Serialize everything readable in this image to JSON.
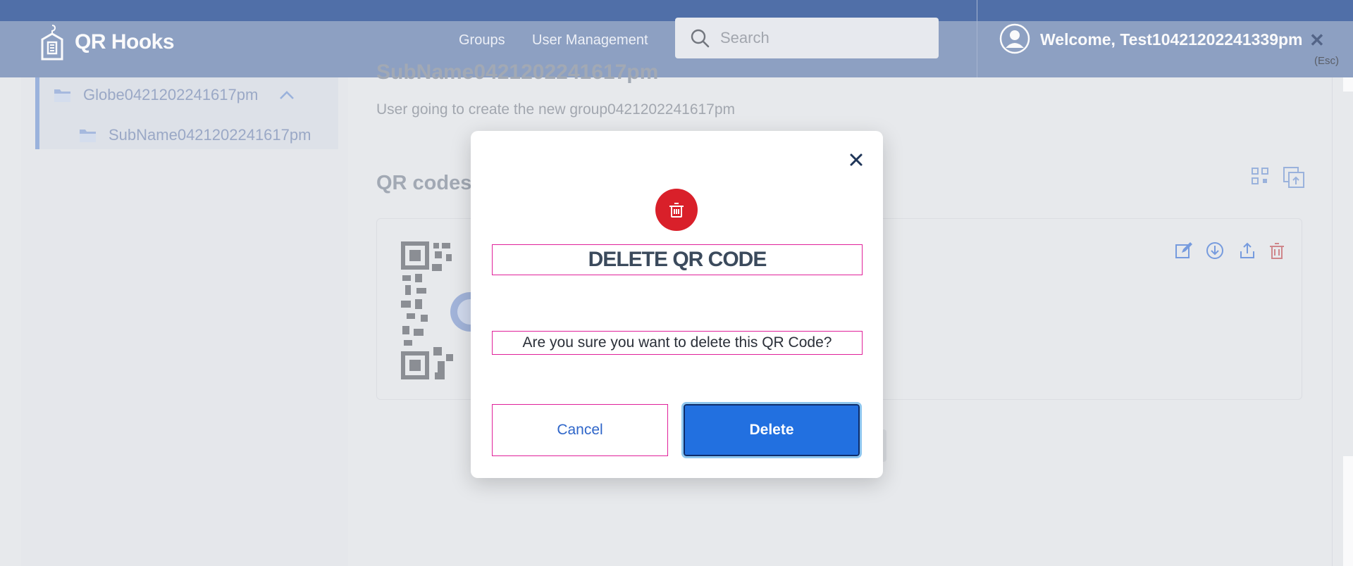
{
  "header": {
    "brand_name": "QR Hooks",
    "nav": {
      "groups": "Groups",
      "user_management": "User Management"
    },
    "search": {
      "placeholder": "Search"
    },
    "welcome": "Welcome, Test10421202241339pm",
    "close_hint": "(Esc)"
  },
  "sidebar": {
    "tree": [
      {
        "label": "Globe0421202241617pm",
        "expanded": true
      },
      {
        "label": "SubName0421202241617pm"
      }
    ]
  },
  "main": {
    "title_partial": "SubName0421202241617pm",
    "description": "User going to create the new group0421202241617pm",
    "qr_section_title": "QR codes"
  },
  "modal": {
    "title": "DELETE QR CODE",
    "message": "Are you sure you want to delete this QR Code?",
    "cancel_label": "Cancel",
    "delete_label": "Delete"
  },
  "colors": {
    "header_bar": "#1d4690",
    "header": "#6e87b3",
    "danger": "#d9202a",
    "primary": "#2270e0",
    "highlight_border": "#e0219a"
  }
}
